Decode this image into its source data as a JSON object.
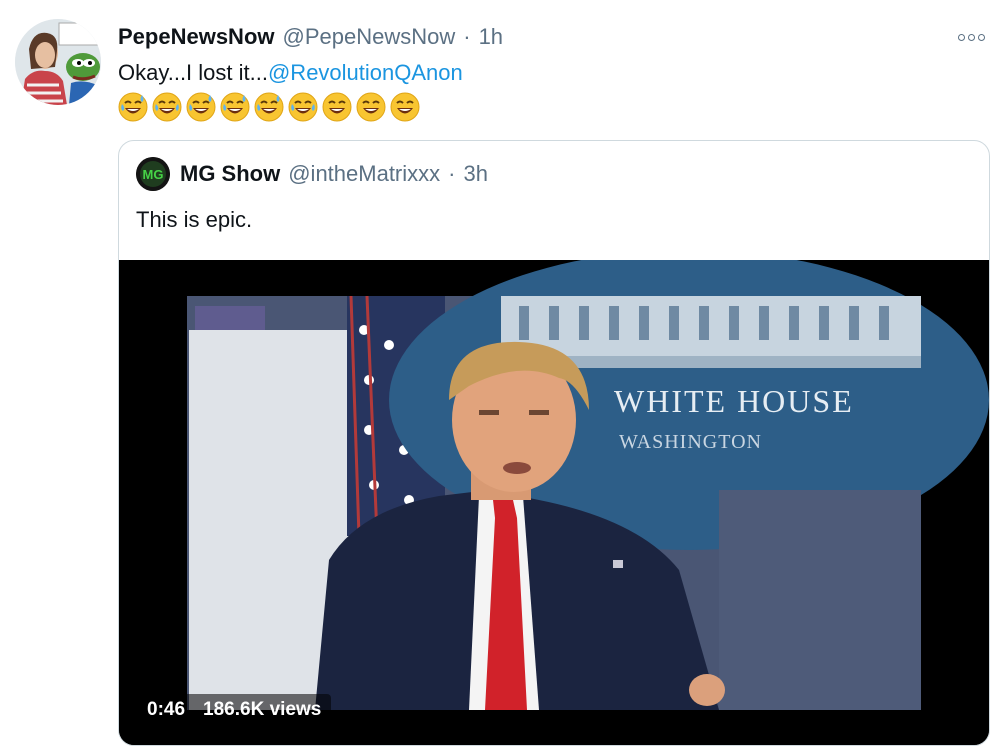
{
  "tweet": {
    "display_name": "PepeNewsNow",
    "handle": "@PepeNewsNow",
    "separator": "·",
    "time": "1h",
    "text_prefix": "Okay...I lost it...",
    "mention": "@RevolutionQAnon",
    "emojis": [
      "sweat-smile",
      "joy",
      "sweat-smile",
      "sweat-smile",
      "sweat-smile",
      "joy",
      "laugh",
      "laugh",
      "laugh"
    ]
  },
  "quoted": {
    "display_name": "MG Show",
    "handle": "@intheMatrixxx",
    "separator": "·",
    "time": "3h",
    "text": "This is epic.",
    "avatar_text": "MG"
  },
  "video": {
    "duration": "0:46",
    "views": "186.6K views",
    "sign_line1": "WHITE HOUSE",
    "sign_line2": "WASHINGTON"
  },
  "colors": {
    "link": "#1b95e0",
    "secondary_text": "#5b7083",
    "border": "#cfd9de"
  }
}
